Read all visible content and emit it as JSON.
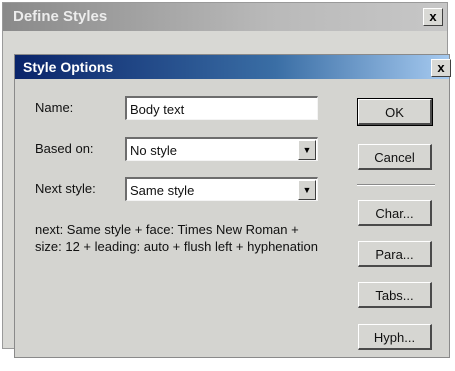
{
  "outer_dialog": {
    "title": "Define Styles",
    "close_label": "x"
  },
  "dialog": {
    "title": "Style Options",
    "close_label": "x",
    "name_label": "Name:",
    "name_value": "Body text",
    "based_on_label": "Based on:",
    "based_on_value": "No style",
    "next_style_label": "Next style:",
    "next_style_value": "Same style",
    "description": "next: Same style + face: Times New Roman + size: 12 + leading: auto + flush left + hyphenation",
    "dropdown_arrow": "▼"
  },
  "buttons": {
    "ok": "OK",
    "cancel": "Cancel",
    "char": "Char...",
    "para": "Para...",
    "tabs": "Tabs...",
    "hyph": "Hyph..."
  },
  "colors": {
    "inner_title_bar": "#0a246a",
    "dialog_face": "#d4d4d0"
  }
}
